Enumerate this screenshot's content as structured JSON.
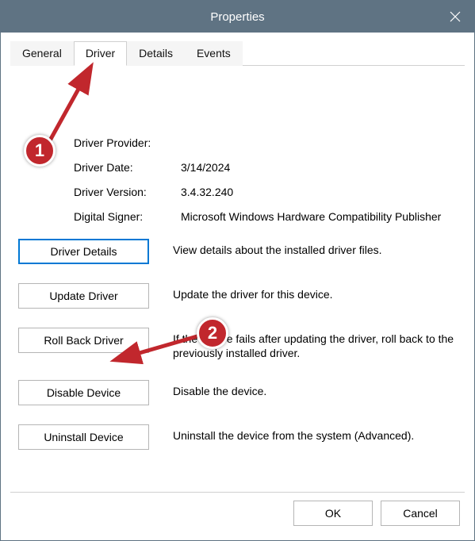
{
  "window": {
    "title": "Properties"
  },
  "tabs": {
    "general": "General",
    "driver": "Driver",
    "details": "Details",
    "events": "Events"
  },
  "info": {
    "provider_label": "Driver Provider:",
    "provider_value": "",
    "date_label": "Driver Date:",
    "date_value": "3/14/2024",
    "version_label": "Driver Version:",
    "version_value": "3.4.32.240",
    "signer_label": "Digital Signer:",
    "signer_value": "Microsoft Windows Hardware Compatibility Publisher"
  },
  "actions": {
    "details": {
      "label": "Driver Details",
      "desc": "View details about the installed driver files."
    },
    "update": {
      "label": "Update Driver",
      "desc": "Update the driver for this device."
    },
    "rollback": {
      "label": "Roll Back Driver",
      "desc": "If the device fails after updating the driver, roll back to the previously installed driver."
    },
    "disable": {
      "label": "Disable Device",
      "desc": "Disable the device."
    },
    "uninstall": {
      "label": "Uninstall Device",
      "desc": "Uninstall the device from the system (Advanced)."
    }
  },
  "footer": {
    "ok": "OK",
    "cancel": "Cancel"
  },
  "annotations": {
    "step1": "1",
    "step2": "2"
  }
}
